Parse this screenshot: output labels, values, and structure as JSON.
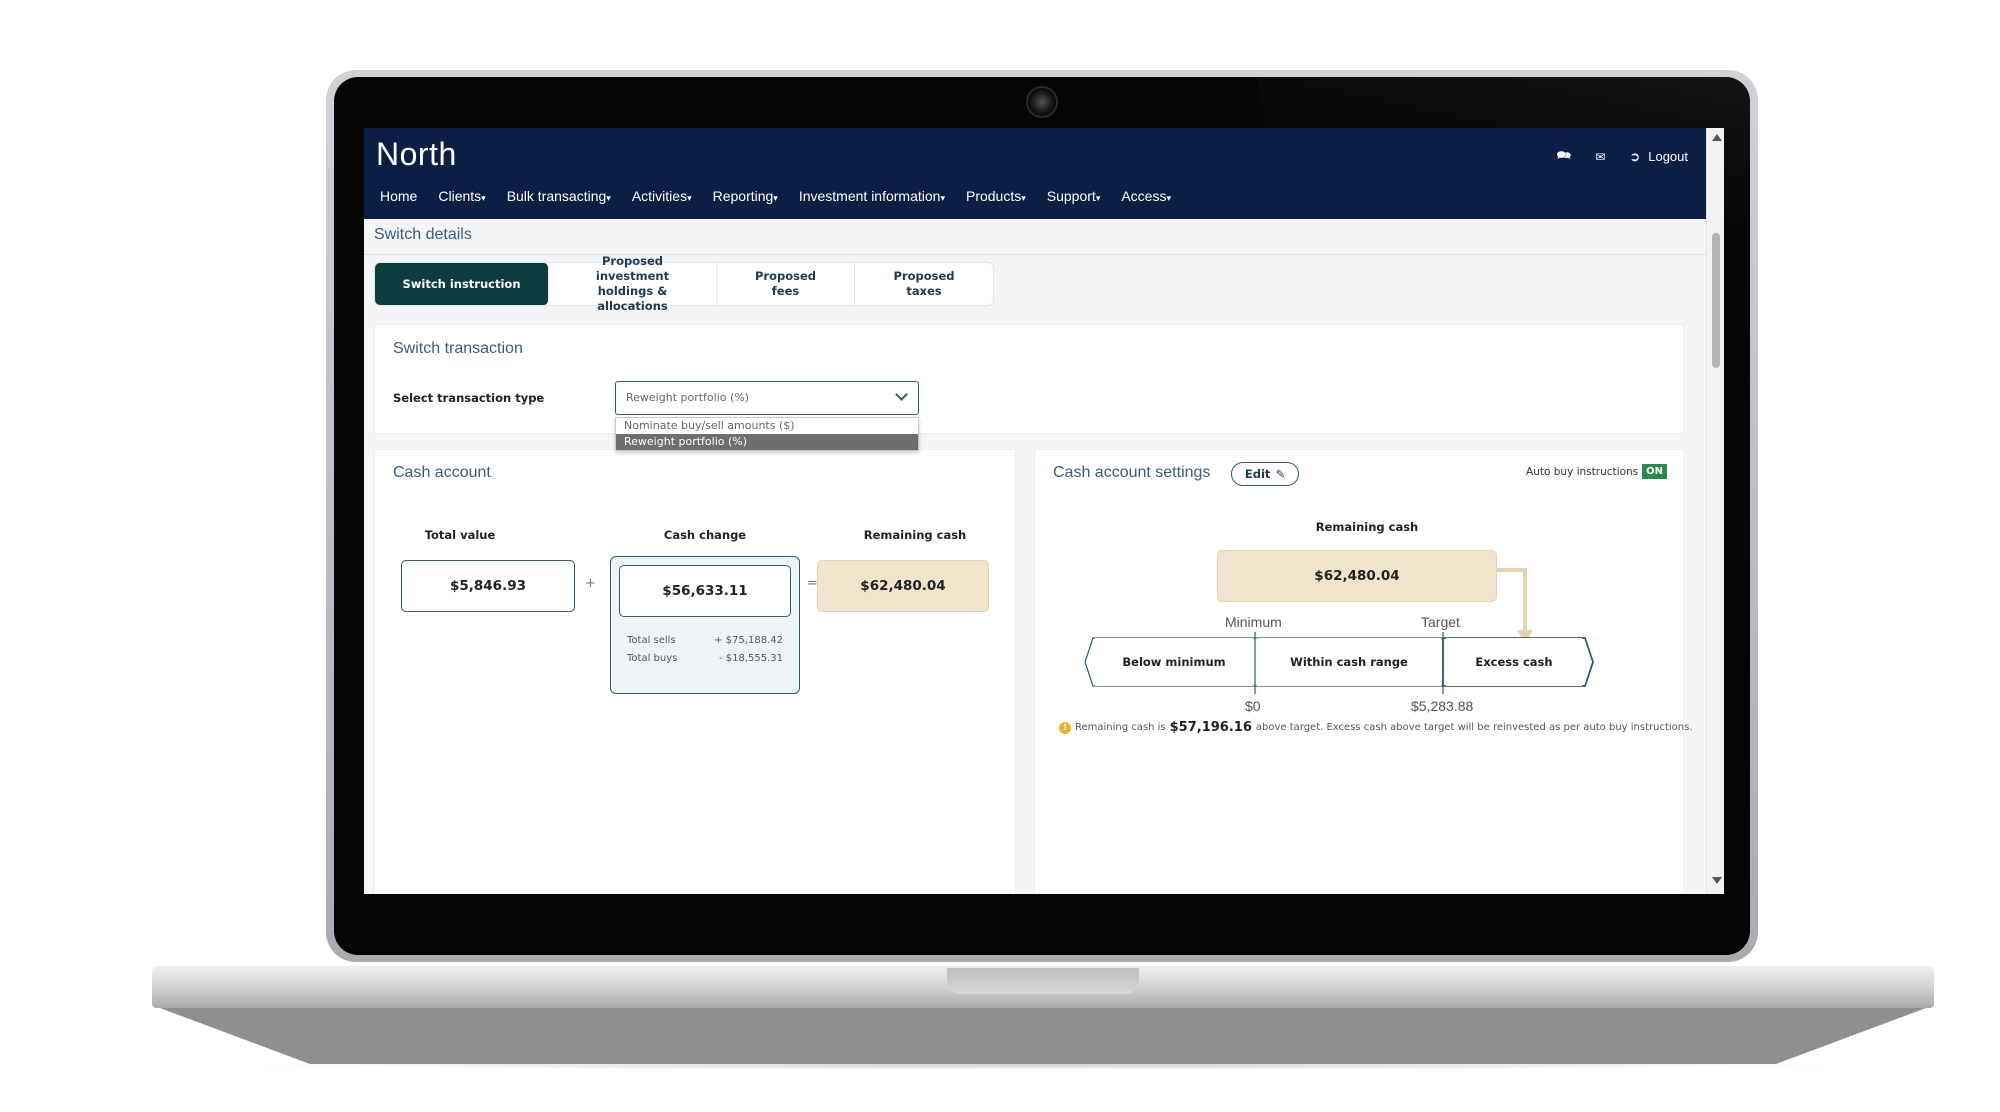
{
  "app": {
    "logo": "North"
  },
  "header": {
    "icons": [
      "chat-icon",
      "mail-icon",
      "logout-icon"
    ],
    "logout_label": "Logout",
    "nav": [
      {
        "label": "Home",
        "has_menu": false
      },
      {
        "label": "Clients",
        "has_menu": true
      },
      {
        "label": "Bulk transacting",
        "has_menu": true
      },
      {
        "label": "Activities",
        "has_menu": true
      },
      {
        "label": "Reporting",
        "has_menu": true
      },
      {
        "label": "Investment information",
        "has_menu": true
      },
      {
        "label": "Products",
        "has_menu": true
      },
      {
        "label": "Support",
        "has_menu": true
      },
      {
        "label": "Access",
        "has_menu": true
      }
    ]
  },
  "page": {
    "title": "Switch details"
  },
  "tabs": [
    {
      "label": "Switch instruction",
      "active": true
    },
    {
      "label": "Proposed investment holdings & allocations",
      "active": false
    },
    {
      "label": "Proposed fees",
      "active": false
    },
    {
      "label": "Proposed taxes",
      "active": false
    }
  ],
  "switch_transaction": {
    "title": "Switch transaction",
    "select_label": "Select transaction type",
    "selected": "Reweight portfolio (%)",
    "options": [
      "Nominate buy/sell amounts ($)",
      "Reweight portfolio (%)"
    ]
  },
  "cash_account": {
    "title": "Cash account",
    "total_value_label": "Total value",
    "total_value": "$5,846.93",
    "cash_change_label": "Cash change",
    "cash_change": "$56,633.11",
    "remaining_cash_label": "Remaining cash",
    "remaining_cash": "$62,480.04",
    "plus": "+",
    "equals": "=",
    "total_sells_label": "Total sells",
    "total_sells": "+ $75,188.42",
    "total_buys_label": "Total buys",
    "total_buys": "- $18,555.31"
  },
  "cash_settings": {
    "title": "Cash account settings",
    "edit_label": "Edit",
    "auto_buy_label": "Auto buy instructions",
    "auto_buy_state": "ON",
    "remaining_cash_label": "Remaining cash",
    "remaining_cash": "$62,480.04",
    "minimum_label": "Minimum",
    "target_label": "Target",
    "segments": [
      "Below minimum",
      "Within cash range",
      "Excess cash"
    ],
    "min_value": "$0",
    "target_value": "$5,283.88",
    "info_prefix": "Remaining cash is",
    "info_amount": "$57,196.16",
    "info_suffix": "above target. Excess cash above target will be reinvested as per auto buy instructions.",
    "accent_color": "#2f5d6b",
    "highlight_color": "#f1e4cc"
  },
  "colors": {
    "header_bg": "#0b1f44",
    "active_tab": "#0d3c3f",
    "on_badge": "#2a8a4a"
  }
}
